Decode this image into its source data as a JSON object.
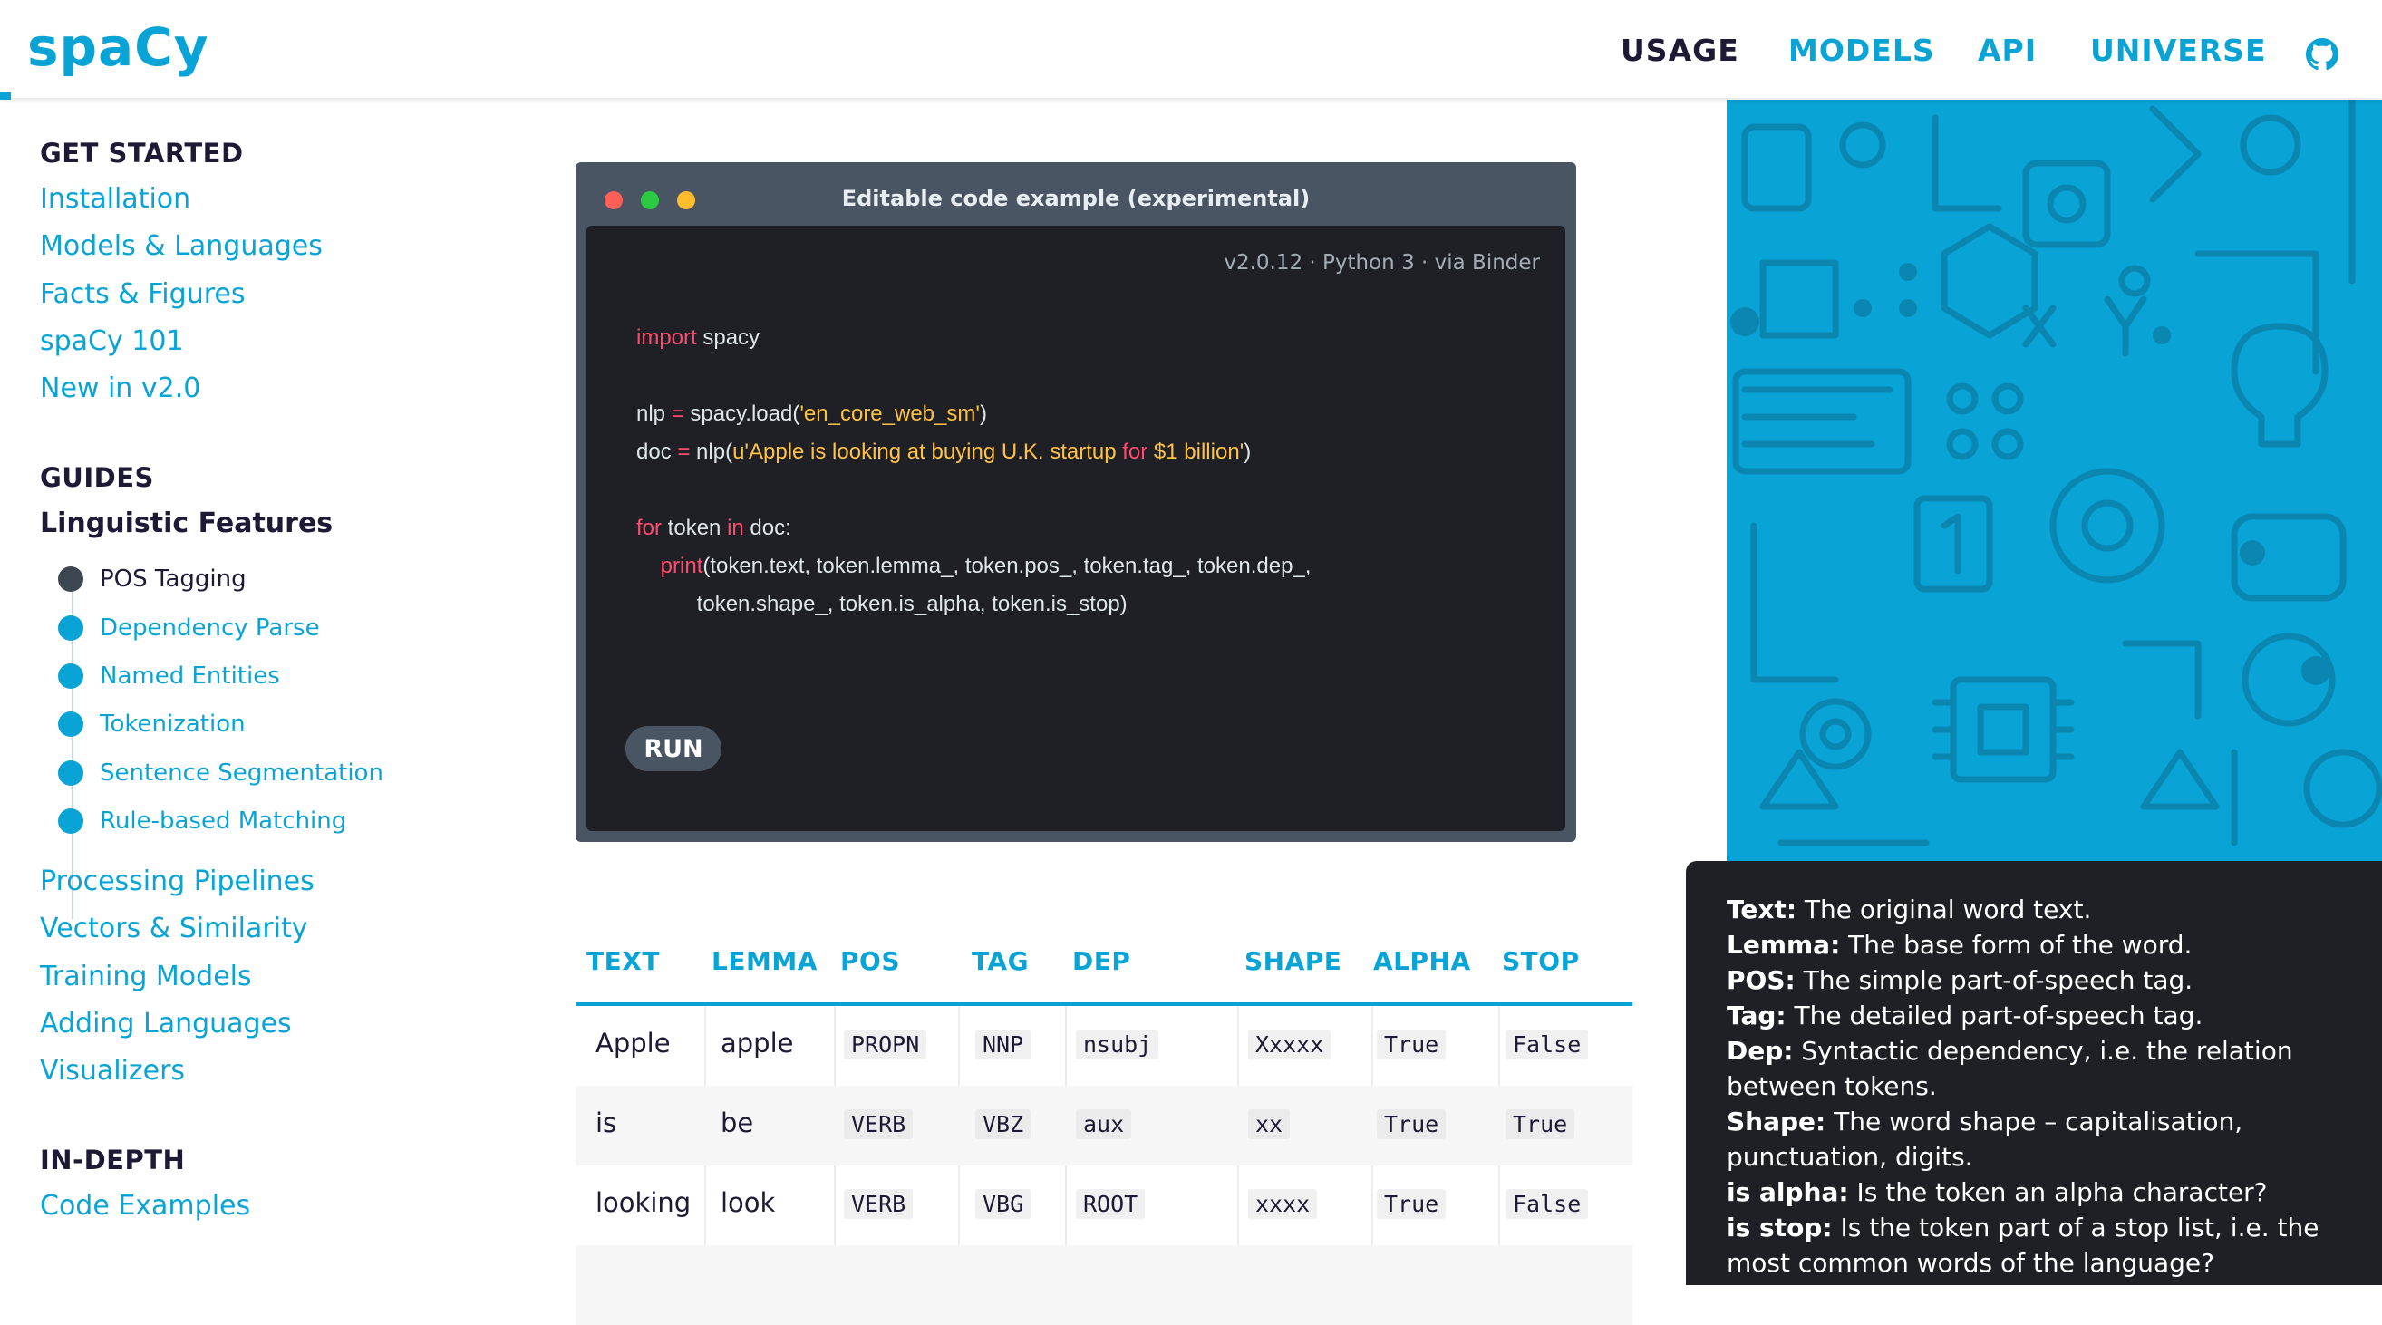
{
  "header": {
    "logo": "spaCy",
    "nav": [
      {
        "label": "USAGE"
      },
      {
        "label": "MODELS"
      },
      {
        "label": "API"
      },
      {
        "label": "UNIVERSE"
      }
    ],
    "icons": [
      "github-icon"
    ]
  },
  "sidebar": {
    "get_started": {
      "title": "GET STARTED",
      "items": [
        "Installation",
        "Models & Languages",
        "Facts & Figures",
        "spaCy 101",
        "New in v2.0"
      ]
    },
    "guides": {
      "title": "GUIDES",
      "current": "Linguistic Features",
      "subitems": [
        {
          "label": "POS Tagging",
          "active": true
        },
        {
          "label": "Dependency Parse",
          "active": false
        },
        {
          "label": "Named Entities",
          "active": false
        },
        {
          "label": "Tokenization",
          "active": false
        },
        {
          "label": "Sentence Segmentation",
          "active": false
        },
        {
          "label": "Rule-based Matching",
          "active": false
        }
      ],
      "items": [
        "Processing Pipelines",
        "Vectors & Similarity",
        "Training Models",
        "Adding Languages",
        "Visualizers"
      ]
    },
    "in_depth": {
      "title": "IN-DEPTH",
      "items": [
        "Code Examples"
      ]
    }
  },
  "code_example": {
    "title": "Editable code example (experimental)",
    "meta": "v2.0.12 · Python 3 · via Binder",
    "lines": [
      "import spacy",
      "",
      "nlp = spacy.load('en_core_web_sm')",
      "doc = nlp(u'Apple is looking at buying U.K. startup for $1 billion')",
      "",
      "for token in doc:",
      "    print(token.text, token.lemma_, token.pos_, token.tag_, token.dep_,",
      "          token.shape_, token.is_alpha, token.is_stop)"
    ],
    "run_label": "RUN"
  },
  "table": {
    "columns": [
      "TEXT",
      "LEMMA",
      "POS",
      "TAG",
      "DEP",
      "SHAPE",
      "ALPHA",
      "STOP"
    ],
    "rows": [
      [
        "Apple",
        "apple",
        "PROPN",
        "NNP",
        "nsubj",
        "Xxxxx",
        "True",
        "False"
      ],
      [
        "is",
        "be",
        "VERB",
        "VBZ",
        "aux",
        "xx",
        "True",
        "True"
      ],
      [
        "looking",
        "look",
        "VERB",
        "VBG",
        "ROOT",
        "xxxx",
        "True",
        "False"
      ]
    ]
  },
  "tooltip": [
    {
      "term": "Text:",
      "desc": " The original word text."
    },
    {
      "term": "Lemma:",
      "desc": " The base form of the word."
    },
    {
      "term": "POS:",
      "desc": " The simple part-of-speech tag."
    },
    {
      "term": "Tag:",
      "desc": " The detailed part-of-speech tag."
    },
    {
      "term": "Dep:",
      "desc": " Syntactic dependency, i.e. the relation between tokens."
    },
    {
      "term": "Shape:",
      "desc": " The word shape – capitalisation, punctuation, digits."
    },
    {
      "term": "is alpha:",
      "desc": " Is the token an alpha character?"
    },
    {
      "term": "is stop:",
      "desc": " Is the token part of a stop list, i.e. the most common words of the language?"
    }
  ],
  "colors": {
    "accent": "#09a3d5",
    "dark": "#1e1935",
    "code_bg": "#1e2026",
    "keyword": "#ff4b6e",
    "string": "#ffc145"
  }
}
